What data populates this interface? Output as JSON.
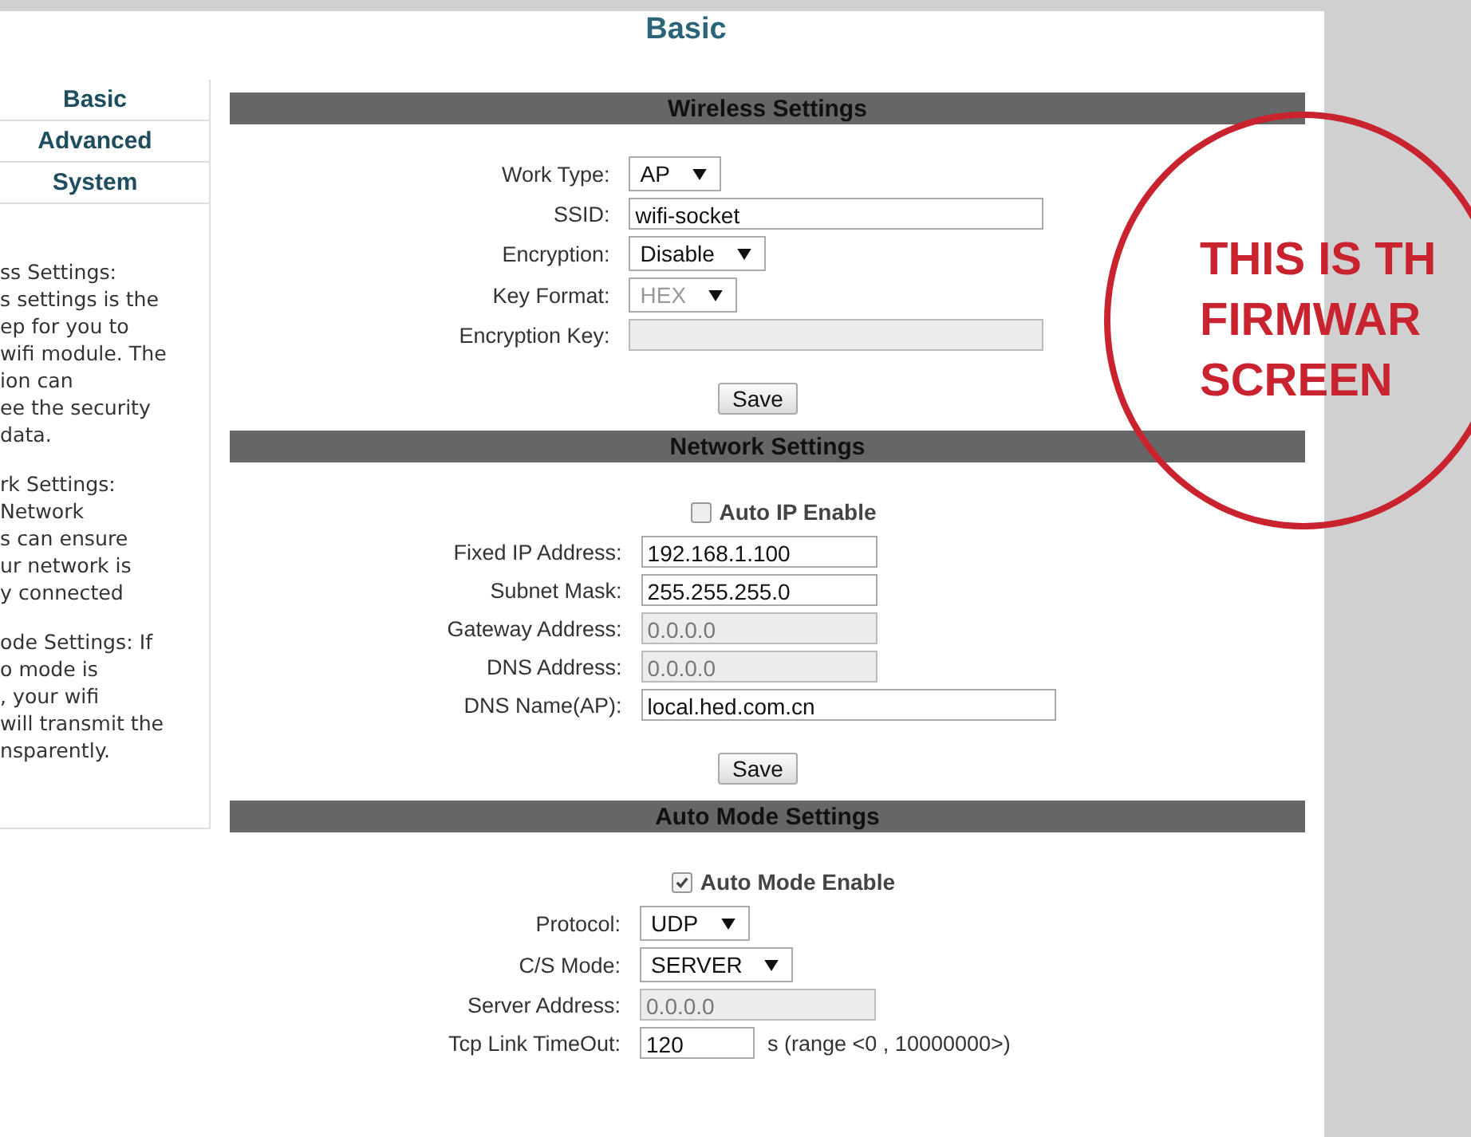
{
  "page_title": "Basic",
  "sidebar": {
    "menu": [
      {
        "label": "Basic"
      },
      {
        "label": "Advanced"
      },
      {
        "label": "System"
      }
    ],
    "help": [
      {
        "lines": [
          "ss Settings:",
          "s settings is the",
          "ep for you to",
          "wifi module. The",
          "ion can",
          "ee the security",
          "data."
        ]
      },
      {
        "lines": [
          "rk Settings:",
          "Network",
          "s can ensure",
          "ur network is",
          "y connected"
        ]
      },
      {
        "lines": [
          "ode Settings: If",
          "o mode is",
          ", your wifi",
          "will transmit the",
          "nsparently."
        ]
      }
    ]
  },
  "sections": [
    {
      "title": "Wireless Settings",
      "button": "Save",
      "rows": [
        {
          "kind": "select",
          "label": "Work Type:",
          "value": "AP",
          "disabled": false
        },
        {
          "kind": "wide_input",
          "label": "SSID:",
          "value": "wifi-socket",
          "disabled": false
        },
        {
          "kind": "select",
          "label": "Encryption:",
          "value": "Disable",
          "disabled": false
        },
        {
          "kind": "select",
          "label": "Key Format:",
          "value": "HEX",
          "disabled": true
        },
        {
          "kind": "wide_input",
          "label": "Encryption Key:",
          "disabled": true
        }
      ]
    },
    {
      "title": "Network Settings",
      "button": "Save",
      "rows": [
        {
          "kind": "checkbox",
          "label": "Auto IP Enable",
          "checked": false
        },
        {
          "kind": "input",
          "label": "Fixed IP Address:",
          "value": "192.168.1.100",
          "disabled": false
        },
        {
          "kind": "input",
          "label": "Subnet Mask:",
          "value": "255.255.255.0",
          "disabled": false
        },
        {
          "kind": "input",
          "label": "Gateway Address:",
          "value": "0.0.0.0",
          "disabled": true
        },
        {
          "kind": "input",
          "label": "DNS Address:",
          "value": "0.0.0.0",
          "disabled": true
        },
        {
          "kind": "wide_input",
          "label": "DNS Name(AP):",
          "value": "local.hed.com.cn",
          "disabled": false
        }
      ]
    },
    {
      "title": "Auto Mode Settings",
      "rows": [
        {
          "kind": "checkbox",
          "label": "Auto Mode Enable",
          "checked": true
        },
        {
          "kind": "select",
          "label": "Protocol:",
          "value": "UDP",
          "disabled": false
        },
        {
          "kind": "select",
          "label": "C/S Mode:",
          "value": "SERVER",
          "disabled": false
        },
        {
          "kind": "input",
          "label": "Server Address:",
          "value": "0.0.0.0",
          "disabled": true
        },
        {
          "kind": "short_input",
          "label": "Tcp Link TimeOut:",
          "value": "120",
          "disabled": false,
          "suffix": "s (range <0 , 10000000>)"
        }
      ]
    }
  ],
  "annotation": {
    "lines": [
      "THIS IS TH",
      "FIRMWAR",
      "SCREEN"
    ]
  }
}
